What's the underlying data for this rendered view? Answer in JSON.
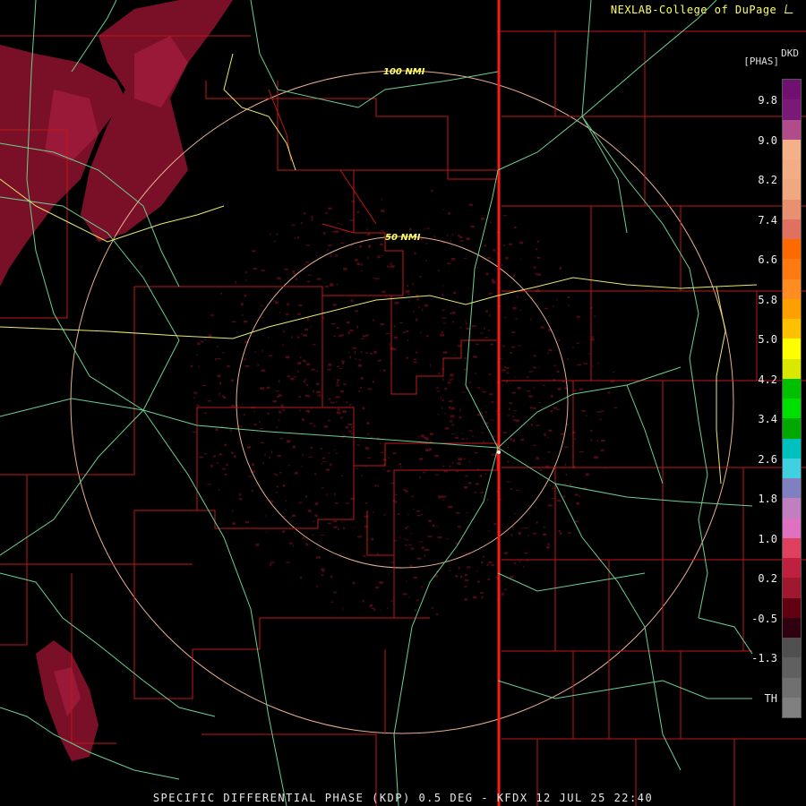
{
  "header": {
    "credit": "NEXLAB-College of DuPage",
    "credit_icon": "small-logo-icon"
  },
  "footer": {
    "product": "SPECIFIC DIFFERENTIAL PHASE (KDP) 0.5 DEG - KFDX 12 JUL 25 22:40"
  },
  "rings": [
    {
      "label": "50 NMI"
    },
    {
      "label": "100 NMI"
    }
  ],
  "legend": {
    "name": "DKD",
    "unit": "[PHAS]",
    "ticks": [
      "9.8",
      "9.0",
      "8.2",
      "7.4",
      "6.6",
      "5.8",
      "5.0",
      "4.2",
      "3.4",
      "2.6",
      "1.8",
      "1.0",
      "0.2",
      "-0.5",
      "-1.3",
      "TH"
    ],
    "colors": [
      "#701070",
      "#7a1a78",
      "#b04c8a",
      "#f4b088",
      "#f2ad86",
      "#f0a880",
      "#e89070",
      "#e07060",
      "#ff6a00",
      "#ff7a10",
      "#ff8c20",
      "#ffa000",
      "#ffc000",
      "#ffff00",
      "#d8e800",
      "#00c000",
      "#00e000",
      "#00a800",
      "#00c0c0",
      "#40d0e0",
      "#8080c0",
      "#c080c0",
      "#e070c0",
      "#e04060",
      "#c02040",
      "#a01830",
      "#600010",
      "#300010",
      "#505050",
      "#606060",
      "#707070",
      "#808080"
    ],
    "accent_ring": "#ffcc99",
    "accent_border": "#ff0000",
    "accent_highway": "#66cc88",
    "accent_river": "#ffff66"
  }
}
